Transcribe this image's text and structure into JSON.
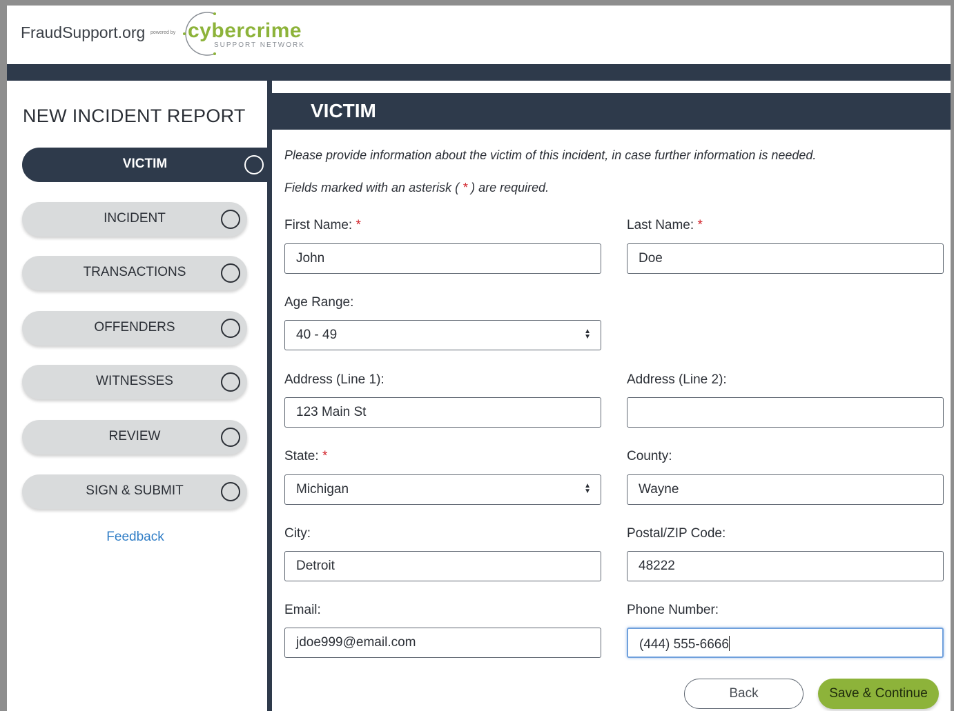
{
  "header": {
    "site_name": "FraudSupport.org",
    "powered_by": "powered by",
    "brand_name": "cybercrime",
    "brand_tagline": "SUPPORT NETWORK",
    "brand_color": "#8db33a",
    "navbar_color": "#2e3a4b"
  },
  "sidebar": {
    "title": "NEW INCIDENT REPORT",
    "steps": [
      {
        "label": "VICTIM",
        "active": true,
        "icon": "circle-icon"
      },
      {
        "label": "INCIDENT",
        "active": false,
        "icon": "circle-icon"
      },
      {
        "label": "TRANSACTIONS",
        "active": false,
        "icon": "circle-icon"
      },
      {
        "label": "OFFENDERS",
        "active": false,
        "icon": "circle-icon"
      },
      {
        "label": "WITNESSES",
        "active": false,
        "icon": "circle-icon"
      },
      {
        "label": "REVIEW",
        "active": false,
        "icon": "circle-icon"
      },
      {
        "label": "SIGN & SUBMIT",
        "active": false,
        "icon": "circle-icon"
      }
    ],
    "feedback_link": "Feedback"
  },
  "main": {
    "section_title": "VICTIM",
    "intro_line": "Please provide information about the victim of this incident, in case further information is needed.",
    "required_note_pre": "Fields marked with an asterisk (",
    "required_star": " * ",
    "required_note_post": ") are required.",
    "fields": {
      "first_name": {
        "label": "First Name:",
        "required": "*",
        "value": "John"
      },
      "last_name": {
        "label": "Last Name:",
        "required": "*",
        "value": "Doe"
      },
      "age_range": {
        "label": "Age Range:",
        "value": "40 - 49"
      },
      "address1": {
        "label": "Address (Line 1):",
        "value": "123 Main St"
      },
      "address2": {
        "label": "Address (Line 2):",
        "value": ""
      },
      "state": {
        "label": "State:",
        "required": "*",
        "value": "Michigan"
      },
      "county": {
        "label": "County:",
        "value": "Wayne"
      },
      "city": {
        "label": "City:",
        "value": "Detroit"
      },
      "zip": {
        "label": "Postal/ZIP Code:",
        "value": "48222"
      },
      "email": {
        "label": "Email:",
        "value": "jdoe999@email.com"
      },
      "phone": {
        "label": "Phone Number:",
        "value": "(444) 555-6666"
      }
    },
    "buttons": {
      "back": "Back",
      "save": "Save & Continue"
    }
  }
}
